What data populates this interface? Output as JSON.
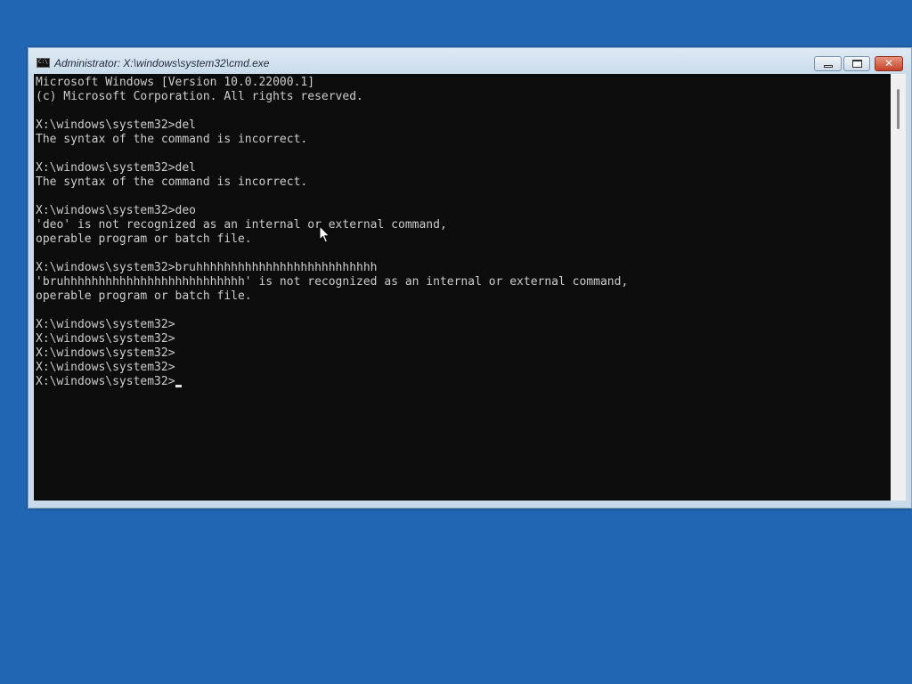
{
  "window": {
    "title": "Administrator: X:\\windows\\system32\\cmd.exe",
    "icon": "cmd-icon",
    "buttons": {
      "minimize": "minimize-icon",
      "maximize": "maximize-icon",
      "close": "✕"
    }
  },
  "console": {
    "lines": [
      "Microsoft Windows [Version 10.0.22000.1]",
      "(c) Microsoft Corporation. All rights reserved.",
      "",
      "X:\\windows\\system32>del",
      "The syntax of the command is incorrect.",
      "",
      "X:\\windows\\system32>del",
      "The syntax of the command is incorrect.",
      "",
      "X:\\windows\\system32>deo",
      "'deo' is not recognized as an internal or external command,",
      "operable program or batch file.",
      "",
      "X:\\windows\\system32>bruhhhhhhhhhhhhhhhhhhhhhhhhhh",
      "'bruhhhhhhhhhhhhhhhhhhhhhhhhhh' is not recognized as an internal or external command,",
      "operable program or batch file.",
      "",
      "X:\\windows\\system32>",
      "X:\\windows\\system32>",
      "X:\\windows\\system32>",
      "X:\\windows\\system32>",
      "X:\\windows\\system32>"
    ]
  },
  "colors": {
    "desktop": "#2166b3",
    "console_background": "#0c0c0c",
    "console_text": "#cccccc",
    "close_button": "#c7432a"
  }
}
